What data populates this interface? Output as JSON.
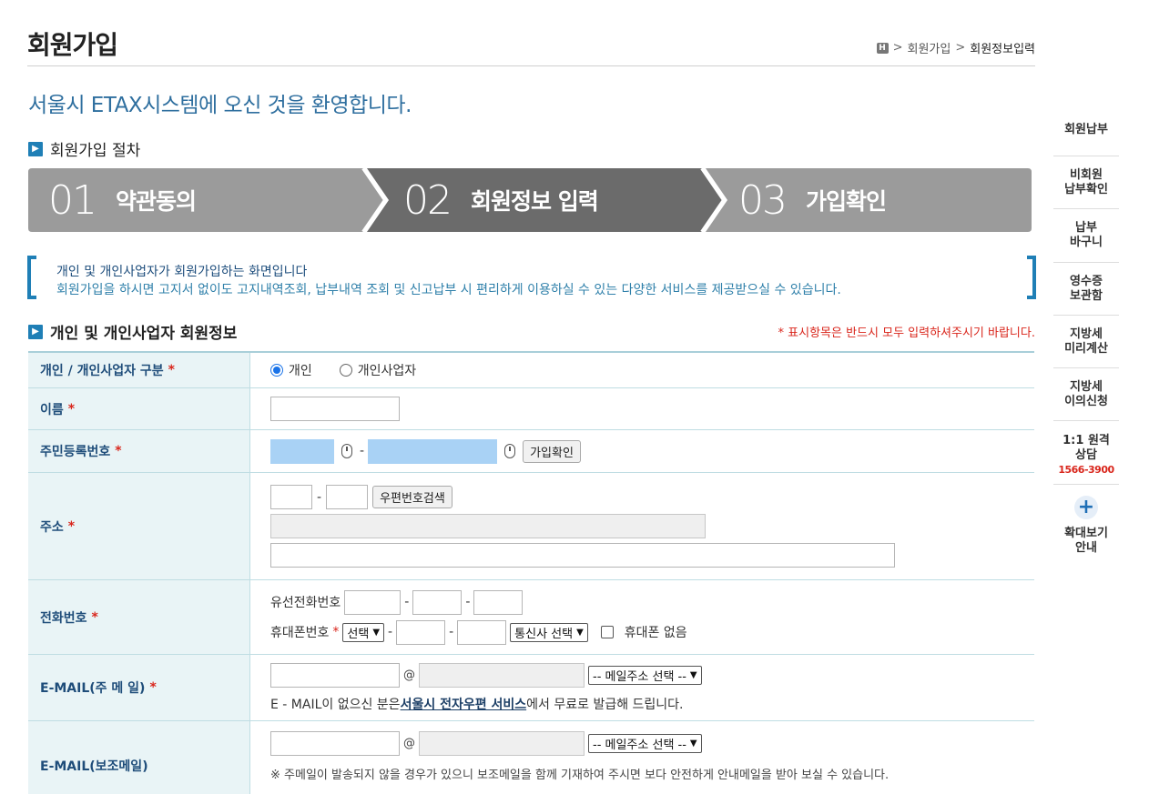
{
  "header": {
    "title": "회원가입",
    "breadcrumb": {
      "home_icon": "home-icon",
      "items": [
        "회원가입",
        "회원정보입력"
      ]
    }
  },
  "welcome": "서울시 ETAX시스템에 오신 것을 환영합니다.",
  "procedure": {
    "title": "회원가입 절차",
    "steps": [
      {
        "num": "01",
        "label": "약관동의"
      },
      {
        "num": "02",
        "label": "회원정보 입력"
      },
      {
        "num": "03",
        "label": "가입확인"
      }
    ],
    "colors": {
      "inactive": "#9b9b9b",
      "active": "#6b6b6b"
    }
  },
  "notice": {
    "title": "개인 및 개인사업자가 회원가입하는 화면입니다",
    "desc": "회원가입을 하시면 고지서 없이도 고지내역조회, 납부내역 조회 및 신고납부 시 편리하게 이용하실 수 있는 다양한 서비스를 제공받으실 수 있습니다."
  },
  "form": {
    "title": "개인 및 개인사업자 회원정보",
    "required_note": "* 표시항목은 반드시 모두 입력하셔주시기 바랍니다.",
    "type": {
      "label": "개인 / 개인사업자 구분",
      "opt1": "개인",
      "opt2": "개인사업자"
    },
    "name": {
      "label": "이름"
    },
    "rrn": {
      "label": "주민등록번호",
      "sep": "-",
      "button": "가입확인"
    },
    "address": {
      "label": "주소",
      "sep": "-",
      "button": "우편번호검색"
    },
    "phone": {
      "label": "전화번호",
      "landline_label": "유선전화번호",
      "mobile_label": "휴대폰번호",
      "select_prefix": "선택",
      "select_carrier": "통신사 선택",
      "no_mobile": "휴대폰 없음",
      "sep": "-"
    },
    "email_main": {
      "label": "E-MAIL(주 메 일)",
      "at": "@",
      "select": "-- 메일주소 선택 --",
      "note_prefix": "E - MAIL이 없으신 분은 ",
      "note_link": "서울시 전자우편 서비스",
      "note_suffix": "에서 무료로 발급해 드립니다."
    },
    "email_sub": {
      "label": "E-MAIL(보조메일)",
      "at": "@",
      "select": "-- 메일주소 선택 --",
      "note": "※ 주메일이 발송되지 않을 경우가 있으니 보조메일을 함께 기재하여 주시면 보다 안전하게 안내메일을 받아 보실 수 있습니다."
    },
    "required_mark": "*"
  },
  "quickbar": {
    "items": [
      {
        "l1": "회원납부",
        "l2": ""
      },
      {
        "l1": "비회원",
        "l2": "납부확인"
      },
      {
        "l1": "납부",
        "l2": "바구니"
      },
      {
        "l1": "영수증",
        "l2": "보관함"
      },
      {
        "l1": "지방세",
        "l2": "미리계산"
      },
      {
        "l1": "지방세",
        "l2": "이의신청"
      }
    ],
    "consult": {
      "l1": "1:1 원격",
      "l2": "상담",
      "phone": "1566-3900"
    },
    "zoom": {
      "icon": "plus-icon",
      "l1": "확대보기",
      "l2": "안내"
    }
  }
}
